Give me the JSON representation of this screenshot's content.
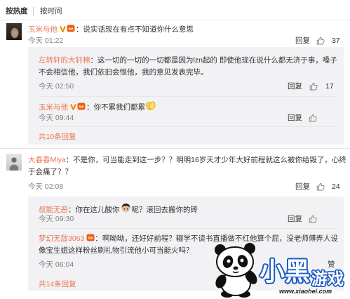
{
  "sort_tabs": [
    {
      "label": "按热度",
      "active": true
    },
    {
      "label": "按时间",
      "active": false
    }
  ],
  "colors": {
    "user_name": "#eb7350",
    "body_text": "#333333",
    "meta_text": "#808080",
    "reply_panel": "#f2f2f5",
    "divider": "#e6e6e6",
    "more_link": "#eb7350",
    "logo_outline": "#1d5bc4"
  },
  "comments": [
    {
      "user": "玉米与他",
      "badges": [
        "verified-v-icon",
        "member-badge-icon"
      ],
      "text": "：说实话现在有点不知道你什么意思",
      "time": "今天 01:22",
      "reply_label": "回复",
      "likes": "37",
      "replies": [
        {
          "user": "左转轩的大轩棉",
          "text": "：这一切的一切的一切都是因为lzn起的  即使他现在说什么都无济于事，嗓子不会相信他，我们依旧会恨他，我的意见发表完毕。",
          "time": "今天 02:50",
          "reply_label": "回复",
          "likes": "17"
        },
        {
          "user": "玉米与他",
          "badges": [
            "verified-v-icon",
            "member-badge-icon"
          ],
          "text": "：你不累我们都累",
          "trailing_emoji": "clap-emoji-icon",
          "time": "今天 09:44",
          "reply_label": "回复"
        }
      ],
      "more_replies": "共10条回复"
    },
    {
      "user": "大春春Miya",
      "text": "：不是你，可当能走到这一步？？明明16岁天才少年大好前程就这么被你给毁了，心终于会痛了？？",
      "time": "今天 02:08",
      "reply_label": "回复",
      "likes": "24",
      "replies": [
        {
          "user": "叔能无恶",
          "text_parts": [
            "：你在这儿酸你",
            "呢？滚回去搬你的砖"
          ],
          "inline_emoji": "face-emoji-icon",
          "time": "今天 09:30",
          "reply_label": "回复"
        },
        {
          "user": "梦幻无敌3063",
          "badges": [
            "member-badge-icon"
          ],
          "text": "：啊呦呦，还好好前程？辍学不读书直播做不红他算个屁，没老师傅弄人设像宝生姐这样粉丝刷礼物引流他小可当能火吗？",
          "time": "今天 06:04",
          "like_label": "赞"
        }
      ],
      "more_replies": "共14条回复"
    }
  ],
  "watermark": {
    "brand_main": "小黑",
    "brand_sub": "游戏",
    "url": "www.xiaohei.com"
  }
}
